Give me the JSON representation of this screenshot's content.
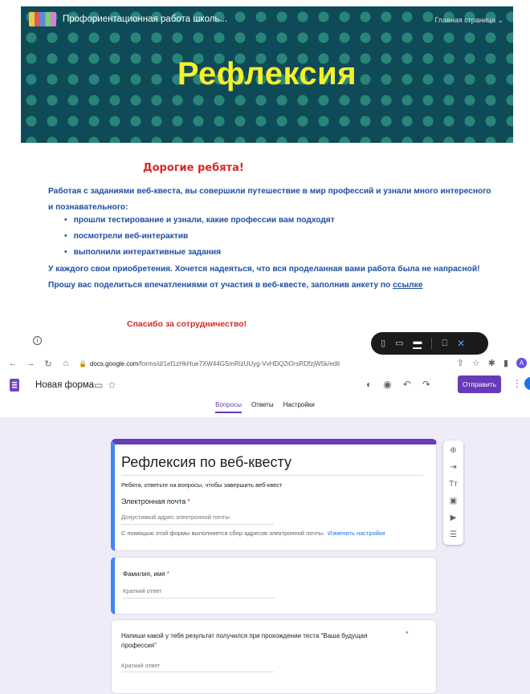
{
  "banner": {
    "site_title": "Профориентационная работа школь...",
    "nav_label": "Главная страница ⌄",
    "heading": "Рефлексия"
  },
  "content": {
    "greeting": "Дорогие ребята!",
    "intro": "Работая с заданиями веб-квеста, вы совершили путешествие  в мир профессий и узнали много интересного и познавательного:",
    "bullets": [
      "прошли тестирование и узнали, какие профессии вам подходят",
      "посмотрели веб-интерактив",
      "выполнили интерактивные задания"
    ],
    "outro_text": "У каждого свои приобретения.  Хочется надеяться, что вся проделанная вами работа была не напрасной! Прошу вас поделиться впечатлениями от участия в веб-квесте, заполнив анкету по ",
    "link_text": "ссылке",
    "thanks": "Спасибо за сотрудничество!"
  },
  "device_preview": {
    "icons": [
      "phone-icon",
      "tablet-icon",
      "laptop-icon",
      "comment-icon",
      "close-icon"
    ]
  },
  "browser": {
    "url_host": "docs.google.com",
    "url_path": "/forms/d/1ef1zHkHue7XW44GSmRlzUUyg-VvHDQ2iOrsRDfzjW5k/edit"
  },
  "forms_header": {
    "form_name": "Новая форма",
    "send_label": "Отправить",
    "tabs": [
      "Вопросы",
      "Ответы",
      "Настройки"
    ]
  },
  "form": {
    "title": "Рефлексия по веб-квесту",
    "description": "Ребята, ответьте на вопросы, чтобы завершить веб-квест",
    "email_label": "Электронная почта",
    "email_placeholder": "Допустимый адрес электронной почты",
    "email_note": "С помощью этой формы выполняется сбор адресов электронной почты.",
    "email_settings_link": "Изменить настройки",
    "q1_label": "Фамилия, имя",
    "q1_placeholder": "Краткий ответ",
    "q2_label": "Напиши какой у тебя результат получился при прохождении теста \"Ваша будущая профессия\"",
    "q2_placeholder": "Краткий ответ",
    "required_mark": "*"
  },
  "colors": {
    "banner_bg": "#0f4a58",
    "banner_heading": "#f5f12a",
    "accent_red": "#d42a2a",
    "text_blue": "#1c4fa3",
    "forms_purple": "#673ab7",
    "form_bg": "#f0ebf8"
  }
}
